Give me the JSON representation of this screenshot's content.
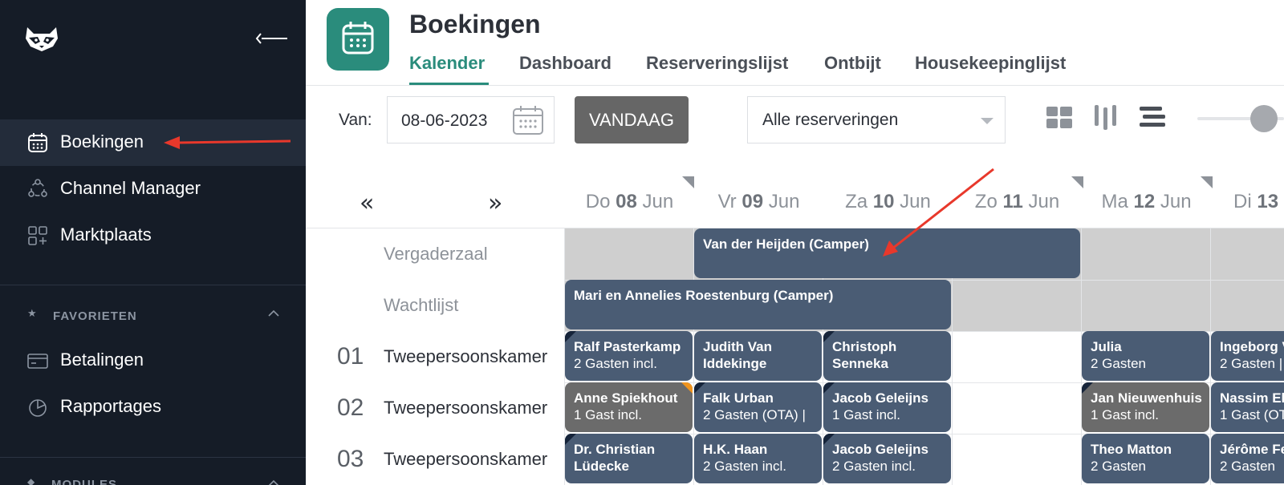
{
  "sidebar": {
    "logo_icon": "raccoon-logo-icon",
    "collapse_icon": "collapse-arrow-icon",
    "nav": [
      {
        "label": "Boekingen",
        "icon": "calendar-icon",
        "active": true
      },
      {
        "label": "Channel Manager",
        "icon": "channel-icon"
      },
      {
        "label": "Marktplaats",
        "icon": "apps-grid-icon"
      }
    ],
    "favorites": {
      "title": "FAVORIETEN",
      "icon": "star-icon",
      "items": [
        {
          "label": "Betalingen",
          "icon": "card-icon"
        },
        {
          "label": "Rapportages",
          "icon": "pie-chart-icon"
        }
      ]
    },
    "modules": {
      "title": "MODULES"
    }
  },
  "header": {
    "title": "Boekingen",
    "icon": "calendar-icon",
    "accent": "#2a8c7c",
    "tabs": [
      {
        "label": "Kalender",
        "active": true
      },
      {
        "label": "Dashboard"
      },
      {
        "label": "Reserveringslijst"
      },
      {
        "label": "Ontbijt"
      },
      {
        "label": "Housekeepinglijst"
      }
    ]
  },
  "toolbar": {
    "from_label": "Van:",
    "date_value": "08-06-2023",
    "today_label": "VANDAAG",
    "filter_value": "Alle reserveringen",
    "view_icons": [
      "grid-view-icon",
      "columns-view-icon",
      "rows-view-icon"
    ]
  },
  "calendar": {
    "prev_label": "«",
    "next_label": "»",
    "days": [
      {
        "dow": "Do",
        "date": "08",
        "month": "Jun"
      },
      {
        "dow": "Vr",
        "date": "09",
        "month": "Jun"
      },
      {
        "dow": "Za",
        "date": "10",
        "month": "Jun"
      },
      {
        "dow": "Zo",
        "date": "11",
        "month": "Jun"
      },
      {
        "dow": "Ma",
        "date": "12",
        "month": "Jun"
      },
      {
        "dow": "Di",
        "date": "13",
        "month": ""
      }
    ],
    "rows": [
      {
        "number": "",
        "name": "Vergaderzaal"
      },
      {
        "number": "",
        "name": "Wachtlijst"
      },
      {
        "number": "01",
        "name": "Tweepersoonskamer"
      },
      {
        "number": "02",
        "name": "Tweepersoonskamer"
      },
      {
        "number": "03",
        "name": "Tweepersoonskamer"
      }
    ],
    "bookings": [
      {
        "name": "Van der Heijden (Camper)",
        "sub": ""
      },
      {
        "name": "Mari en Annelies Roestenburg (Camper)",
        "sub": ""
      },
      {
        "name": "Ralf Pasterkamp",
        "sub": "2 Gasten incl."
      },
      {
        "name": "Judith Van",
        "sub": "Iddekinge"
      },
      {
        "name": "Christoph",
        "sub": "Senneka"
      },
      {
        "name": "Julia",
        "sub": "2 Gasten"
      },
      {
        "name": "Ingeborg V",
        "sub": "2 Gasten |"
      },
      {
        "name": "Anne Spiekhout",
        "sub": "1 Gast incl."
      },
      {
        "name": "Falk Urban",
        "sub": "2 Gasten (OTA) |"
      },
      {
        "name": "Jacob Geleijns",
        "sub": "1 Gast incl."
      },
      {
        "name": "Jan Nieuwenhuis",
        "sub": "1 Gast incl."
      },
      {
        "name": "Nassim El",
        "sub": "1 Gast (OT"
      },
      {
        "name": "Dr. Christian",
        "sub": "Lüdecke"
      },
      {
        "name": "H.K. Haan",
        "sub": "2 Gasten incl."
      },
      {
        "name": "Jacob Geleijns",
        "sub": "2 Gasten incl."
      },
      {
        "name": "Theo Matton",
        "sub": "2 Gasten"
      },
      {
        "name": "Jérôme Fe",
        "sub": "2 Gasten"
      }
    ],
    "colors": {
      "booking": "#4a5c74",
      "booking_grey": "#6b6b6b",
      "blocked": "#cfcfcf",
      "flag": "#16243a",
      "flag_orange": "#f0941e"
    }
  },
  "annotations": {
    "arrow_color": "#e8382b"
  }
}
